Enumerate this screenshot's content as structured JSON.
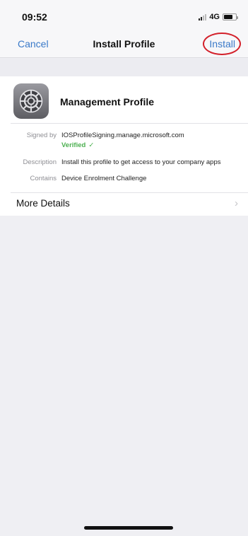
{
  "status_bar": {
    "time": "09:52",
    "network": "4G"
  },
  "nav": {
    "cancel_label": "Cancel",
    "title": "Install Profile",
    "install_label": "Install"
  },
  "profile": {
    "name": "Management Profile",
    "icon": "settings-gear-icon"
  },
  "details": {
    "signed_by_label": "Signed by",
    "signed_by_value": "IOSProfileSigning.manage.microsoft.com",
    "verified_label": "Verified",
    "description_label": "Description",
    "description_value": "Install this profile to get access to your company apps",
    "contains_label": "Contains",
    "contains_value": "Device Enrolment Challenge"
  },
  "more_details_label": "More Details",
  "colors": {
    "accent": "#3a79c8",
    "verified": "#4cb050",
    "highlight": "#d3202a"
  }
}
